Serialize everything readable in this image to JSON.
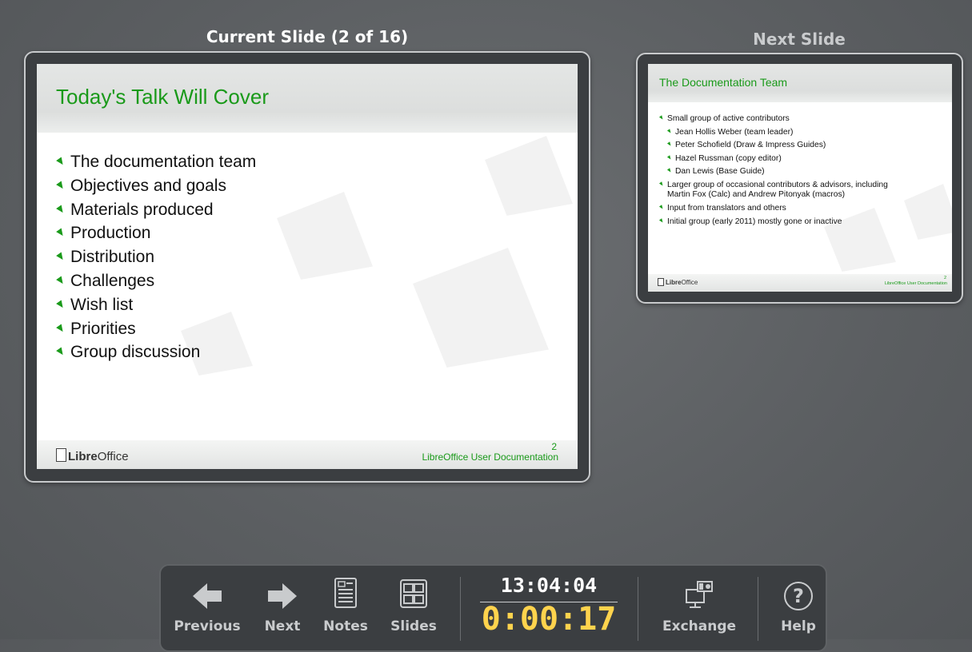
{
  "current_pane": {
    "title": "Current Slide (2 of 16)",
    "slide": {
      "heading": "Today's Talk Will Cover",
      "bullets": [
        "The documentation team",
        "Objectives and goals",
        "Materials produced",
        "Production",
        "Distribution",
        "Challenges",
        "Wish list",
        "Priorities",
        "Group discussion"
      ],
      "footer_brand_bold": "Libre",
      "footer_brand_light": "Office",
      "footer_doc": "LibreOffice User Documentation",
      "slide_number": "2"
    }
  },
  "next_pane": {
    "title": "Next Slide",
    "slide": {
      "heading": "The Documentation Team",
      "bullets": [
        "Small group of active contributors",
        "Jean Hollis Weber (team leader)",
        "Peter Schofield (Draw & Impress Guides)",
        "Hazel Russman (copy editor)",
        "Dan Lewis (Base Guide)",
        "Larger group of occasional contributors & advisors, including",
        "Martin Fox (Calc) and Andrew Pitonyak (macros)",
        "Input from translators and others",
        "Initial group (early 2011) mostly gone or inactive"
      ],
      "footer_brand_bold": "Libre",
      "footer_brand_light": "Office",
      "footer_doc": "LibreOffice User Documentation",
      "slide_number": "2"
    }
  },
  "toolbar": {
    "previous_label": "Previous",
    "next_label": "Next",
    "notes_label": "Notes",
    "slides_label": "Slides",
    "clock": "13:04:04",
    "timer": "0:00:17",
    "exchange_label": "Exchange",
    "help_label": "Help"
  },
  "colors": {
    "accent_green": "#1a9a1a",
    "timer_yellow": "#ffd34d",
    "background": "#5b5e61"
  },
  "icons": [
    "arrow-left-icon",
    "arrow-right-icon",
    "notes-icon",
    "slides-grid-icon",
    "exchange-monitor-icon",
    "help-icon"
  ]
}
